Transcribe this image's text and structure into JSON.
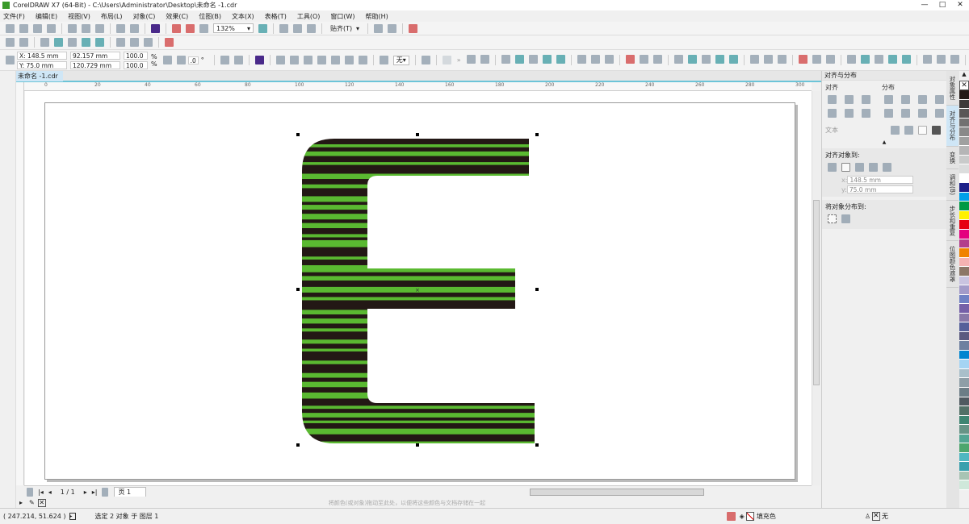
{
  "window": {
    "title": "CorelDRAW X7 (64-Bit) - C:\\Users\\Administrator\\Desktop\\未命名 -1.cdr",
    "controls": [
      "—",
      "□",
      "✕"
    ]
  },
  "menu": [
    "文件(F)",
    "编辑(E)",
    "视图(V)",
    "布局(L)",
    "对象(C)",
    "效果(C)",
    "位图(B)",
    "文本(X)",
    "表格(T)",
    "工具(O)",
    "窗口(W)",
    "帮助(H)"
  ],
  "toolbar": {
    "zoom": "132%",
    "snap": "贴齐(T)"
  },
  "propbar": {
    "x": "X: 148.5 mm",
    "y": "Y: 75.0 mm",
    "width": "92.157 mm",
    "height": "120.729 mm",
    "scale_w": "100.0",
    "scale_h": "100.0",
    "pct": "%",
    "rotation": ".0",
    "degree": "°",
    "outline": "无"
  },
  "document": {
    "tab": "未命名 -1.cdr"
  },
  "ruler": {
    "h_ticks": [
      "0",
      "20",
      "40",
      "60",
      "80",
      "100",
      "120",
      "140",
      "160",
      "180",
      "200",
      "220",
      "240",
      "260",
      "280",
      "300"
    ]
  },
  "artwork": {
    "green": "#5ab931",
    "dark": "#231815"
  },
  "pagenav": {
    "counter": "1 / 1",
    "page_tab": "页 1"
  },
  "colorwell": {
    "hint": "将颜色(或对象)拖动至此处，以便将这些颜色与文档存储在一起"
  },
  "status": {
    "coords": "( 247.214, 51.624 )",
    "selection": "选定 2 对象 于 图层 1",
    "fill": "填充色",
    "outline": "无"
  },
  "docker": {
    "title": "对齐与分布",
    "align": "对齐",
    "distribute": "分布",
    "text": "文本",
    "align_to": "对齐对象到:",
    "x": "148.5 mm",
    "y": "75.0 mm",
    "x_label": "x:",
    "y_label": "y:",
    "distribute_to": "将对象分布到:"
  },
  "vtabs": [
    "对象属性",
    "对齐与分布",
    "变换",
    "调和(B)",
    "步长和重复",
    "位图颜色遮罩"
  ],
  "palette": [
    "#231815",
    "#3e3a39",
    "#595757",
    "#727171",
    "#898989",
    "#9fa0a0",
    "#b5b5b6",
    "#c9caca",
    "#dcdddd",
    "#ffffff",
    "#1d2088",
    "#00a0e9",
    "#009944",
    "#fff100",
    "#e60012",
    "#e4007f",
    "#b33e8c",
    "#f08300",
    "#f5b2b2",
    "#8c7667",
    "#c9c3e0",
    "#a39bc9",
    "#7081c4",
    "#7560a8",
    "#8878a8",
    "#55609a",
    "#5a5a80",
    "#6e80a0",
    "#0085d0",
    "#a5d4f3",
    "#a9bfca",
    "#8e9ea7",
    "#6c7d86",
    "#4f5960",
    "#527067",
    "#3f8572",
    "#679486",
    "#53a593",
    "#4ea66e",
    "#50b7c1",
    "#3aa0ae",
    "#a8c4b4",
    "#cfe8da"
  ]
}
